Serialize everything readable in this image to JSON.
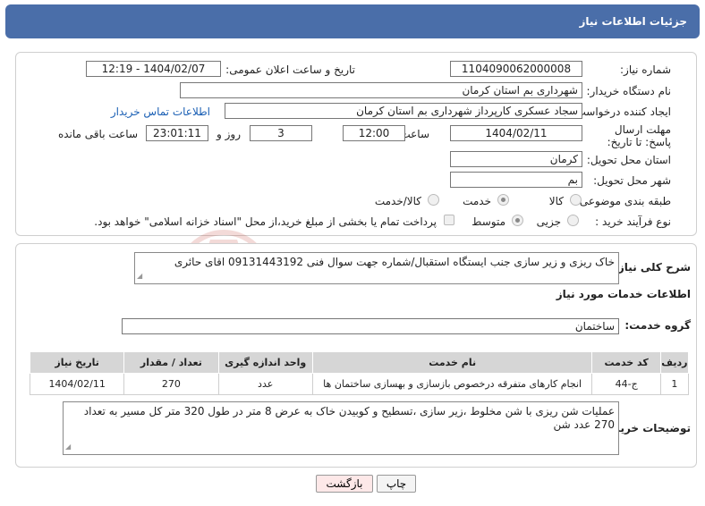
{
  "header": {
    "title": "جزئیات اطلاعات نیاز"
  },
  "form": {
    "need_number": {
      "label": "شماره نیاز:",
      "value": "1104090062000008"
    },
    "announce": {
      "label": "تاریخ و ساعت اعلان عمومی:",
      "value": "1404/02/07 - 12:19"
    },
    "buyer_org": {
      "label": "نام دستگاه خریدار:",
      "value": "شهرداری بم استان کرمان"
    },
    "requester": {
      "label": "ایجاد کننده درخواست:",
      "value": "سجاد عسکری کارپرداز شهرداری بم استان کرمان",
      "contact_link": "اطلاعات تماس خریدار"
    },
    "deadline": {
      "label": "مهلت ارسال پاسخ: تا تاریخ:",
      "date": "1404/02/11",
      "time_label": "ساعت",
      "time": "12:00",
      "days": "3",
      "days_label": "روز و",
      "remaining": "23:01:11",
      "remaining_label": "ساعت باقی مانده"
    },
    "province": {
      "label": "استان محل تحویل:",
      "value": "کرمان"
    },
    "city": {
      "label": "شهر محل تحویل:",
      "value": "بم"
    },
    "category": {
      "label": "طبقه بندی موضوعی:",
      "options": [
        "کالا",
        "خدمت",
        "کالا/خدمت"
      ],
      "selected": "خدمت"
    },
    "process": {
      "label": "نوع فرآیند خرید :",
      "options": [
        "جزیی",
        "متوسط"
      ],
      "selected": "متوسط",
      "payment_note": "پرداخت تمام یا بخشی از مبلغ خرید،از محل \"اسناد خزانه اسلامی\" خواهد بود."
    }
  },
  "details": {
    "summary_label": "شرح کلی نیاز:",
    "summary": "خاک ریزی و زیر سازی جنب ایستگاه استقبال/شماره جهت سوال فنی 09131443192 اقای حائری",
    "services_title": "اطلاعات خدمات مورد نیاز",
    "service_group_label": "گروه خدمت:",
    "service_group": "ساختمان",
    "table": {
      "headers": [
        "ردیف",
        "کد خدمت",
        "نام خدمت",
        "واحد اندازه گیری",
        "تعداد / مقدار",
        "تاریخ نیاز"
      ],
      "rows": [
        [
          "1",
          "ج-44",
          "انجام کارهای متفرقه درخصوص بازسازی و بهسازی ساختمان ها",
          "عدد",
          "270",
          "1404/02/11"
        ]
      ]
    },
    "buyer_notes_label": "توضیحات خریدار:",
    "buyer_notes": "عملیات شن ریزی با شن مخلوط ،زیر سازی ،تسطیح و کوبیدن خاک به عرض 8 متر در طول 320 متر کل مسیر به تعداد 270 عدد شن"
  },
  "buttons": {
    "print": "چاپ",
    "back": "بازگشت"
  },
  "colors": {
    "header": "#4a6ea9",
    "link": "#1a5fb4",
    "back_button": "#fde8e8"
  }
}
